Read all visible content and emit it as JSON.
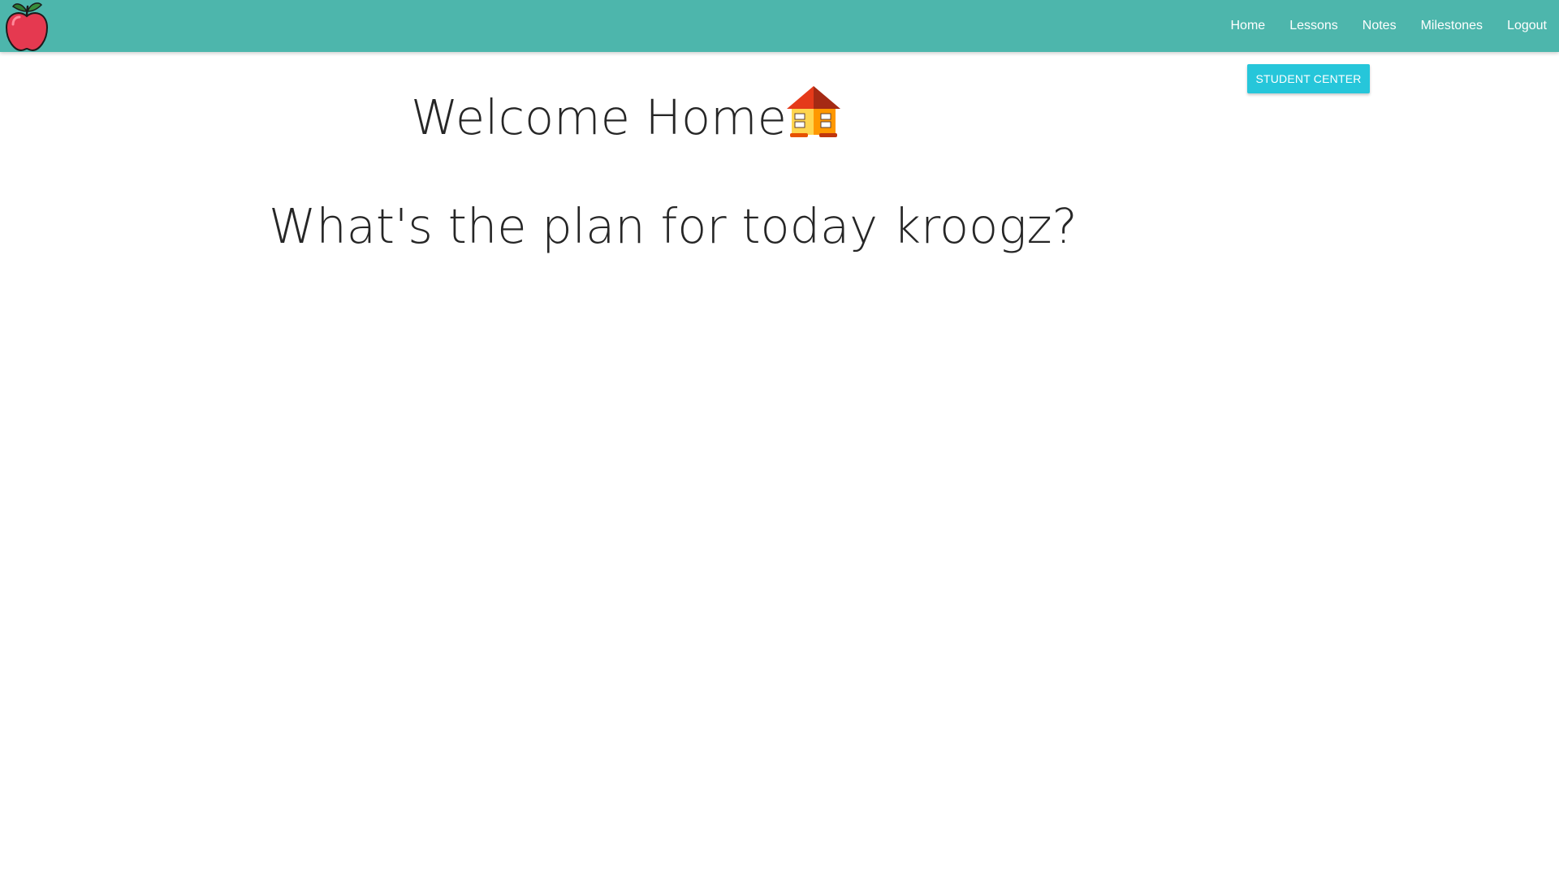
{
  "navbar": {
    "bg_color": "#4db6ac",
    "logo_icon": "apple-icon",
    "links": [
      {
        "label": "Home"
      },
      {
        "label": "Lessons"
      },
      {
        "label": "Notes"
      },
      {
        "label": "Milestones"
      },
      {
        "label": "Logout"
      }
    ]
  },
  "main": {
    "student_center_label": "STUDENT CENTER",
    "student_center_color": "#26c6da",
    "welcome_title": "Welcome Home",
    "welcome_icon": "house-icon",
    "plan_heading": "What's the plan for today kroogz?"
  }
}
